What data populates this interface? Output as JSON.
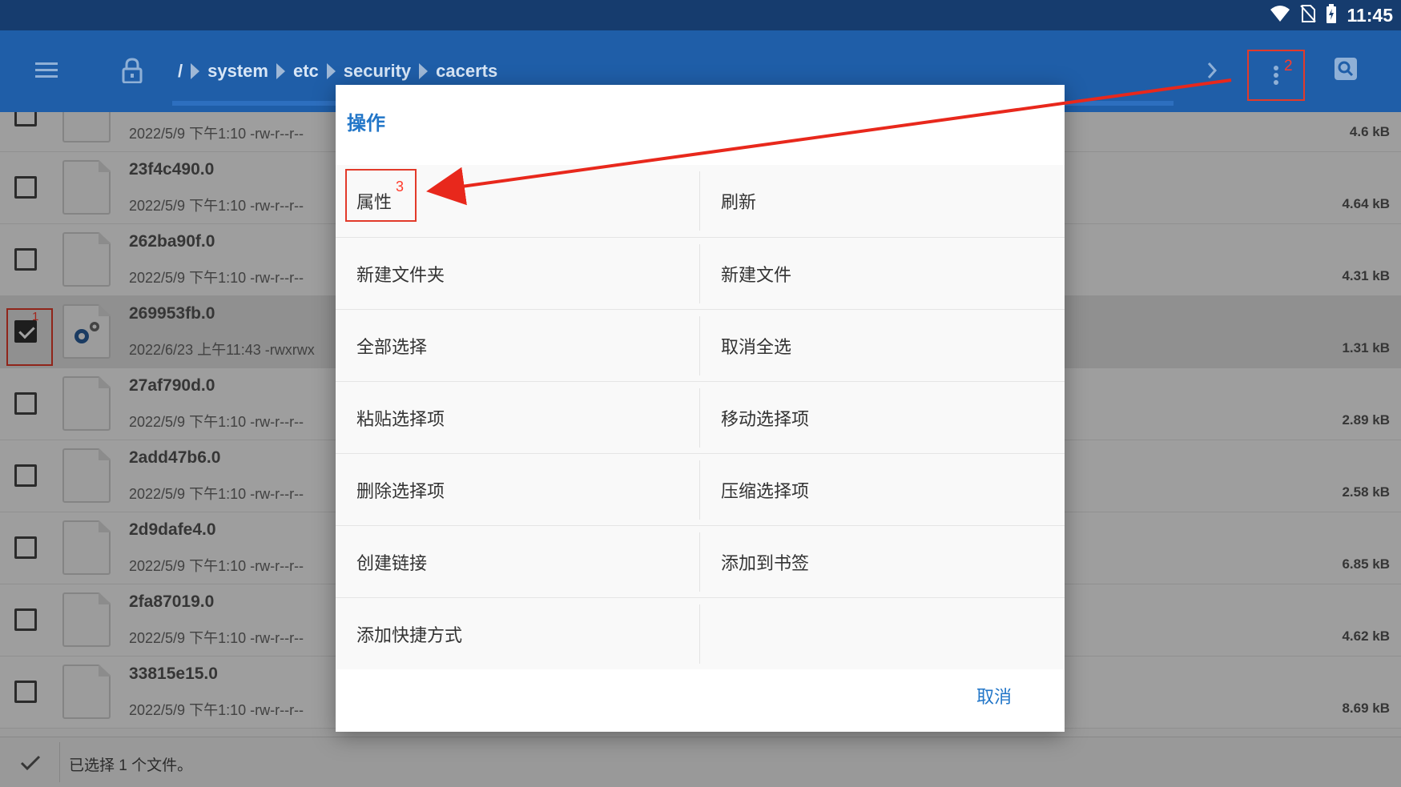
{
  "status_bar": {
    "time": "11:45",
    "icons": [
      "wifi-icon",
      "no-sim-icon",
      "battery-charging-icon"
    ]
  },
  "toolbar": {
    "icons": {
      "menu": "menu-icon",
      "lock": "lock-icon",
      "forward": "chevron-right-icon",
      "more": "more-vert-icon",
      "search": "search-icon"
    },
    "breadcrumb": [
      "/",
      "system",
      "etc",
      "security",
      "cacerts"
    ],
    "more_annotation": "2"
  },
  "files": [
    {
      "name": "",
      "meta": "2022/5/9 下午1:10   -rw-r--r--",
      "size": "4.6 kB",
      "checked": false
    },
    {
      "name": "23f4c490.0",
      "meta": "2022/5/9 下午1:10   -rw-r--r--",
      "size": "4.64 kB",
      "checked": false
    },
    {
      "name": "262ba90f.0",
      "meta": "2022/5/9 下午1:10   -rw-r--r--",
      "size": "4.31 kB",
      "checked": false
    },
    {
      "name": "269953fb.0",
      "meta": "2022/6/23 上午11:43   -rwxrwx",
      "size": "1.31 kB",
      "checked": true,
      "annotation": "1"
    },
    {
      "name": "27af790d.0",
      "meta": "2022/5/9 下午1:10   -rw-r--r--",
      "size": "2.89 kB",
      "checked": false
    },
    {
      "name": "2add47b6.0",
      "meta": "2022/5/9 下午1:10   -rw-r--r--",
      "size": "2.58 kB",
      "checked": false
    },
    {
      "name": "2d9dafe4.0",
      "meta": "2022/5/9 下午1:10   -rw-r--r--",
      "size": "6.85 kB",
      "checked": false
    },
    {
      "name": "2fa87019.0",
      "meta": "2022/5/9 下午1:10   -rw-r--r--",
      "size": "4.62 kB",
      "checked": false
    },
    {
      "name": "33815e15.0",
      "meta": "2022/5/9 下午1:10   -rw-r--r--",
      "size": "8.69 kB",
      "checked": false
    }
  ],
  "bottom_bar": {
    "status": "已选择 1 个文件。"
  },
  "dialog": {
    "title": "操作",
    "items": [
      [
        "属性",
        "刷新"
      ],
      [
        "新建文件夹",
        "新建文件"
      ],
      [
        "全部选择",
        "取消全选"
      ],
      [
        "粘贴选择项",
        "移动选择项"
      ],
      [
        "删除选择项",
        "压缩选择项"
      ],
      [
        "创建链接",
        "添加到书签"
      ],
      [
        "添加快捷方式",
        ""
      ]
    ],
    "highlight_annotation": "3",
    "cancel": "取消"
  },
  "colors": {
    "appbar": "#1f5ea8",
    "statusbar": "#163c6e",
    "accent": "#2276c8",
    "annotation": "#e23a2a"
  }
}
